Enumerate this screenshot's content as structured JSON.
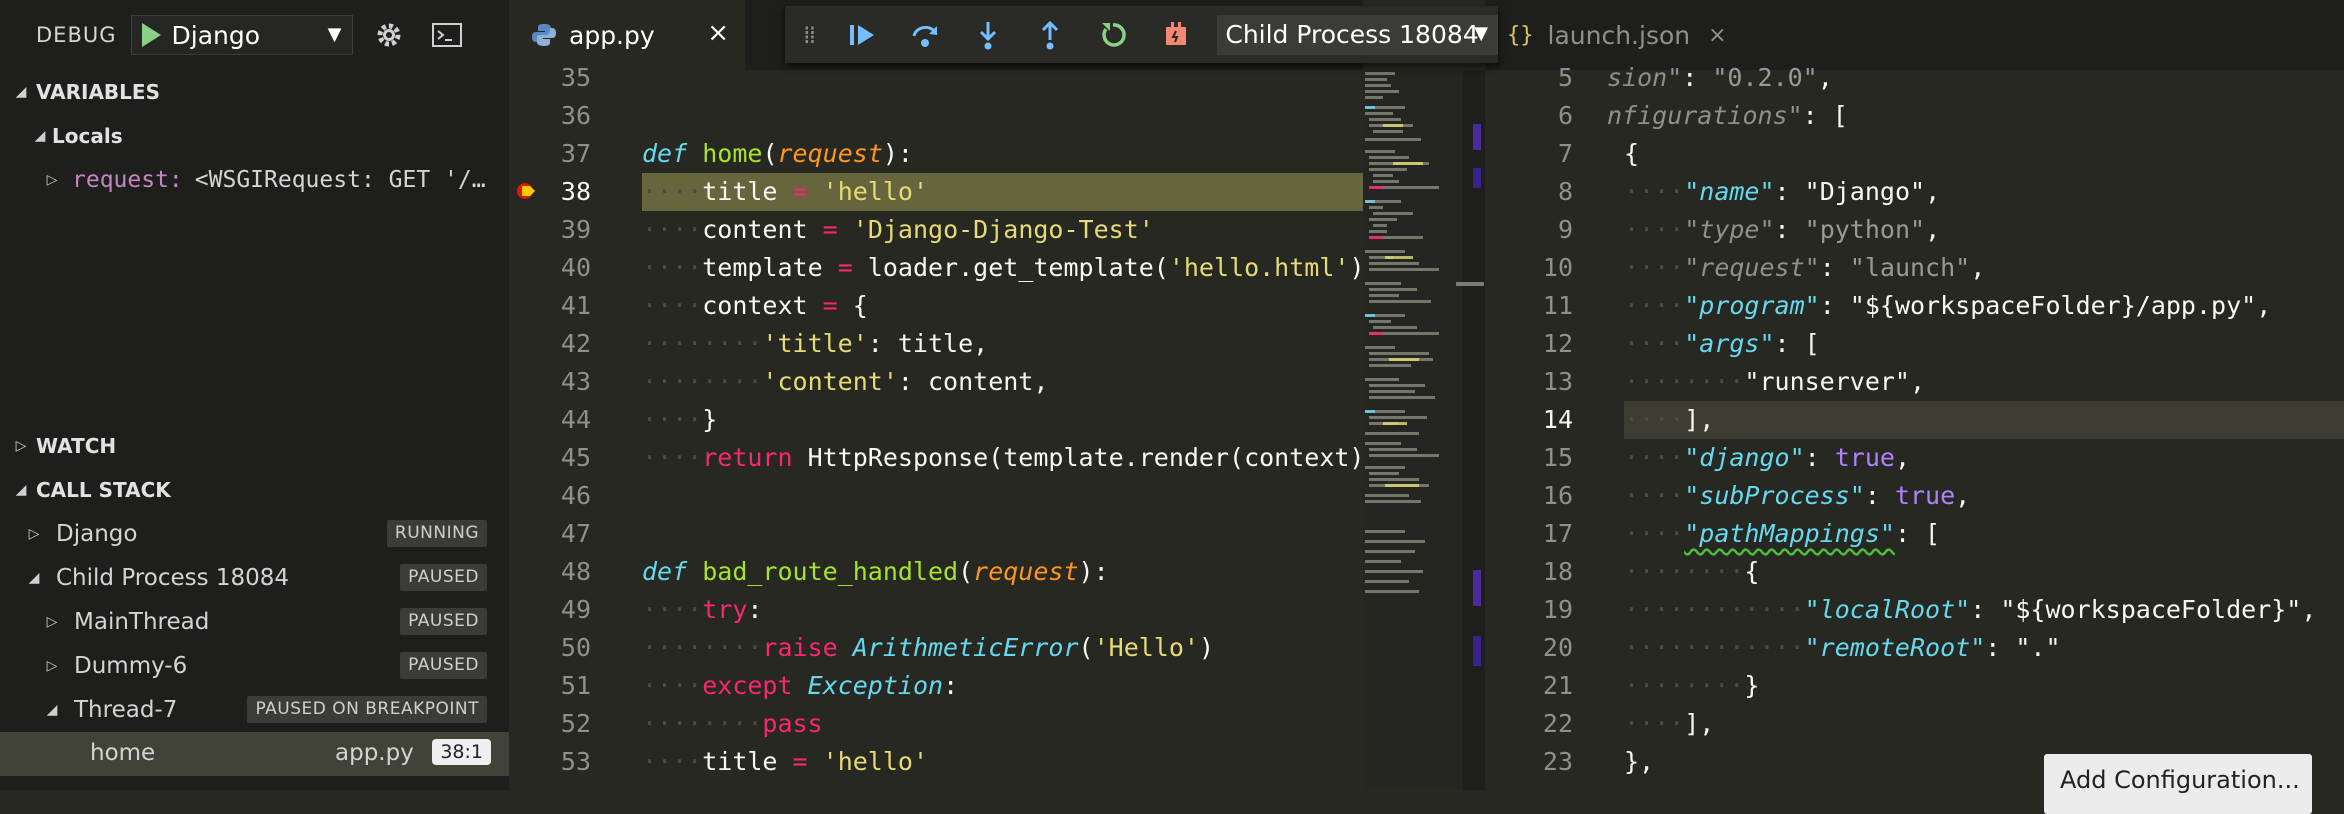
{
  "sidebar": {
    "debug_title": "DEBUG",
    "config_name": "Django",
    "variables_header": "VARIABLES",
    "locals_label": "Locals",
    "variable_name": "request:",
    "variable_value": "<WSGIRequest: GET '/…",
    "watch_header": "WATCH",
    "call_stack_header": "CALL STACK",
    "call_stack": [
      {
        "label": "Django",
        "status": "RUNNING"
      },
      {
        "label": "Child Process 18084",
        "status": "PAUSED"
      },
      {
        "label": "MainThread",
        "status": "PAUSED"
      },
      {
        "label": "Dummy-6",
        "status": "PAUSED"
      },
      {
        "label": "Thread-7",
        "status": "PAUSED ON BREAKPOINT"
      }
    ],
    "frame": {
      "name": "home",
      "file": "app.py",
      "position": "38:1"
    }
  },
  "editor1": {
    "tab_label": "app.py",
    "tab_close": "×",
    "line_numbers": [
      "35",
      "36",
      "37",
      "38",
      "39",
      "40",
      "41",
      "42",
      "43",
      "44",
      "45",
      "46",
      "47",
      "48",
      "49",
      "50",
      "51",
      "52",
      "53"
    ]
  },
  "debug_toolbar": {
    "process_label": "Child Process 18084"
  },
  "editor2": {
    "tab_icon": "{}",
    "tab_label": "launch.json",
    "tab_close": "×",
    "line_numbers": [
      "5",
      "6",
      "7",
      "8",
      "9",
      "10",
      "11",
      "12",
      "13",
      "14",
      "15",
      "16",
      "17",
      "18",
      "19",
      "20",
      "21",
      "22",
      "23"
    ],
    "add_config_label": "Add Configuration..."
  },
  "colors": {
    "background": "#272822",
    "sidebar": "#1e1f1c",
    "current_line": "#66653d",
    "keyword": "#66d9ef",
    "function": "#a6e22e",
    "string": "#e6db74",
    "operator": "#f92672"
  },
  "icons": [
    "play-icon",
    "gear-icon",
    "terminal-icon",
    "python-icon",
    "continue-icon",
    "step-over-icon",
    "step-into-icon",
    "step-out-icon",
    "restart-icon",
    "disconnect-icon",
    "breakpoint-arrow-icon",
    "json-icon"
  ]
}
